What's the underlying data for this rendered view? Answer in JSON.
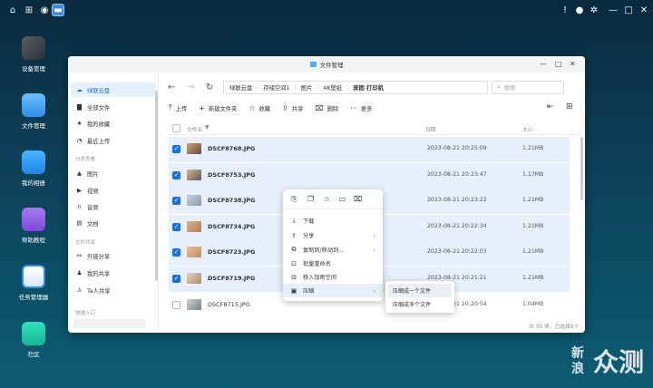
{
  "desktop": {
    "apps": [
      {
        "label": "设备管理",
        "icon": "device-manager-icon"
      },
      {
        "label": "文件管理",
        "icon": "file-manager-icon"
      },
      {
        "label": "我的相册",
        "icon": "photo-album-icon"
      },
      {
        "label": "帮助教程",
        "icon": "help-tutorial-icon"
      },
      {
        "label": "任务管理器",
        "icon": "task-manager-icon"
      },
      {
        "label": "社区",
        "icon": "community-icon"
      }
    ]
  },
  "window": {
    "title": "文件管理"
  },
  "sidebar": {
    "items": [
      {
        "label": "绿联云盘",
        "icon": "cloud-icon"
      },
      {
        "label": "全部文件",
        "icon": "folder-icon"
      },
      {
        "label": "我的收藏",
        "icon": "star-icon"
      },
      {
        "label": "最近上传",
        "icon": "clock-icon"
      }
    ],
    "section_category": "分类查看",
    "category_items": [
      {
        "label": "图片",
        "icon": "image-icon"
      },
      {
        "label": "视频",
        "icon": "video-icon"
      },
      {
        "label": "音频",
        "icon": "headphones-icon"
      },
      {
        "label": "文档",
        "icon": "document-icon"
      }
    ],
    "section_share": "文件共享",
    "share_items": [
      {
        "label": "外链分享",
        "icon": "link-icon"
      },
      {
        "label": "我的共享",
        "icon": "people-icon"
      },
      {
        "label": "Ta人共享",
        "icon": "person-icon"
      }
    ],
    "section_quick": "快捷入口"
  },
  "breadcrumb": [
    "绿联云盘",
    "存储空间1",
    "图片",
    "4K壁纸",
    "奔图 打印机"
  ],
  "search": {
    "placeholder": "搜索"
  },
  "toolbar": {
    "upload": "上传",
    "new_folder": "新建文件夹",
    "favorite": "收藏",
    "share": "共享",
    "delete": "删除",
    "more": "更多"
  },
  "columns": {
    "name": "文件名",
    "date": "日期",
    "size": "大小"
  },
  "files": [
    {
      "name": "DSCF8768.JPG",
      "date": "2023-08-21 20:25:09",
      "size": "1.21MB",
      "selected": true
    },
    {
      "name": "DSCF8753.JPG",
      "date": "2023-08-21 20:23:47",
      "size": "1.17MB",
      "selected": true
    },
    {
      "name": "DSCF8738.JPG",
      "date": "2023-08-21 20:23:22",
      "size": "1.21MB",
      "selected": true
    },
    {
      "name": "DSCF8734.JPG",
      "date": "2023-08-21 20:22:34",
      "size": "1.21MB",
      "selected": true
    },
    {
      "name": "DSCF8723.JPG",
      "date": "2023-08-21 20:22:03",
      "size": "1.21MB",
      "selected": true
    },
    {
      "name": "DSCF8719.JPG",
      "date": "2023-08-21 20:21:21",
      "size": "1.21MB",
      "selected": true
    },
    {
      "name": "DSCF8715.JPG",
      "date": "2023-08-21 20:20:54",
      "size": "1.04MB",
      "selected": false
    }
  ],
  "status": "共 30 项，已选择6个",
  "context_menu": {
    "items": [
      {
        "label": "下载",
        "icon": "download-icon",
        "submenu": false
      },
      {
        "label": "分享",
        "icon": "share-icon",
        "submenu": true
      },
      {
        "label": "复制到/移动到...",
        "icon": "copy-move-icon",
        "submenu": true
      },
      {
        "label": "批量重命名",
        "icon": "rename-icon",
        "submenu": false
      },
      {
        "label": "移入加密空间",
        "icon": "lock-icon",
        "submenu": false
      },
      {
        "label": "压缩",
        "icon": "compress-icon",
        "submenu": true
      }
    ],
    "compress_submenu": [
      "压缩成一个文件",
      "压缩成多个文件"
    ]
  },
  "watermark": {
    "small": "新浪",
    "big": "众测"
  },
  "colors": {
    "accent": "#1e6fd9",
    "selection": "#e6effb"
  }
}
